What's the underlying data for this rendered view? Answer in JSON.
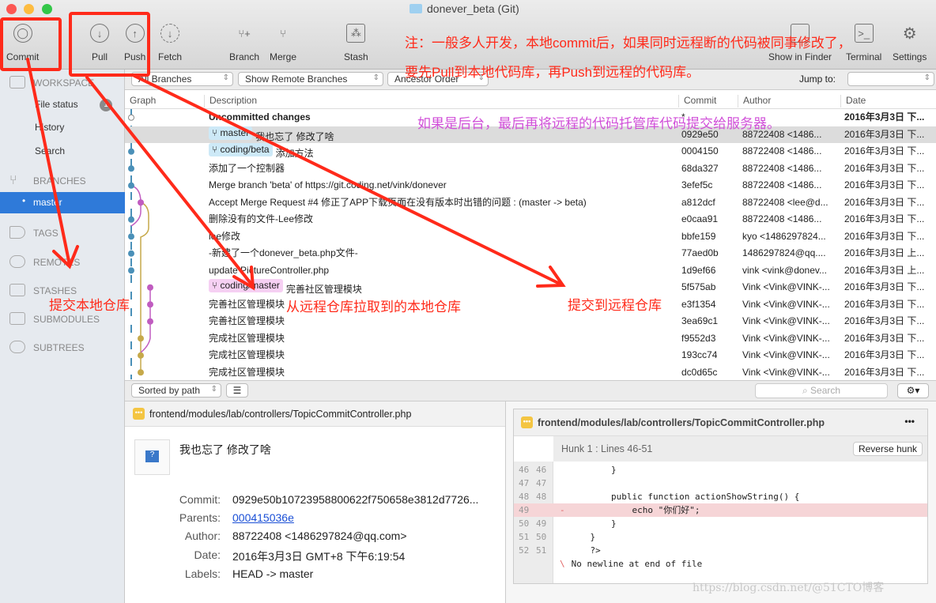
{
  "window": {
    "title": "donever_beta (Git)"
  },
  "toolbar": {
    "commit": "Commit",
    "pull": "Pull",
    "push": "Push",
    "fetch": "Fetch",
    "branch": "Branch",
    "merge": "Merge",
    "stash": "Stash",
    "show_in_finder": "Show in Finder",
    "terminal": "Terminal",
    "settings": "Settings"
  },
  "sidebar": {
    "workspace": "WORKSPACE",
    "file_status": "File status",
    "file_status_count": "1",
    "history": "History",
    "search": "Search",
    "branches": "BRANCHES",
    "master": "master",
    "tags": "TAGS",
    "remotes": "REMOTES",
    "stashes": "STASHES",
    "submodules": "SUBMODULES",
    "subtrees": "SUBTREES"
  },
  "filters": {
    "branches": "All Branches",
    "remote": "Show Remote Branches",
    "order": "Ancestor Order",
    "jump_to": "Jump to:"
  },
  "columns": {
    "graph": "Graph",
    "description": "Description",
    "commit": "Commit",
    "author": "Author",
    "date": "Date"
  },
  "rows": [
    {
      "desc": "Uncommitted changes",
      "commit": "*",
      "author": "",
      "date": "2016年3月3日 下..."
    },
    {
      "tag": "master",
      "desc": "我也忘了 修改了啥",
      "commit": "0929e50",
      "author": "88722408 <1486...",
      "date": "2016年3月3日 下..."
    },
    {
      "tag": "coding/beta",
      "desc": "添加方法",
      "commit": "0004150",
      "author": "88722408 <1486...",
      "date": "2016年3月3日 下..."
    },
    {
      "desc": "添加了一个控制器",
      "commit": "68da327",
      "author": "88722408 <1486...",
      "date": "2016年3月3日 下..."
    },
    {
      "desc": "Merge branch 'beta' of https://git.coding.net/vink/donever",
      "commit": "3efef5c",
      "author": "88722408 <1486...",
      "date": "2016年3月3日 下..."
    },
    {
      "desc": "Accept Merge Request #4 修正了APP下载页面在没有版本时出错的问题 : (master -> beta)",
      "commit": "a812dcf",
      "author": "88722408 <lee@d...",
      "date": "2016年3月3日 下..."
    },
    {
      "desc": "删除没有的文件-Lee修改",
      "commit": "e0caa91",
      "author": "88722408 <1486...",
      "date": "2016年3月3日 下..."
    },
    {
      "desc": "lee修改",
      "commit": "bbfe159",
      "author": "kyo <1486297824...",
      "date": "2016年3月3日 下..."
    },
    {
      "desc": "-新建了一个donever_beta.php文件-",
      "commit": "77aed0b",
      "author": "1486297824@qq....",
      "date": "2016年3月3日 上..."
    },
    {
      "desc": "update PictureController.php",
      "commit": "1d9ef66",
      "author": "vink <vink@donev...",
      "date": "2016年3月3日 上..."
    },
    {
      "tag": "coding/master",
      "desc": "完善社区管理模块",
      "commit": "5f575ab",
      "author": "Vink <Vink@VINK-...",
      "date": "2016年3月3日 下..."
    },
    {
      "desc": "完善社区管理模块",
      "commit": "e3f1354",
      "author": "Vink <Vink@VINK-...",
      "date": "2016年3月3日 下..."
    },
    {
      "desc": "完善社区管理模块",
      "commit": "3ea69c1",
      "author": "Vink <Vink@VINK-...",
      "date": "2016年3月3日 下..."
    },
    {
      "desc": "完成社区管理模块",
      "commit": "f9552d3",
      "author": "Vink <Vink@VINK-...",
      "date": "2016年3月3日 下..."
    },
    {
      "desc": "完成社区管理模块",
      "commit": "193cc74",
      "author": "Vink <Vink@VINK-...",
      "date": "2016年3月3日 下..."
    },
    {
      "desc": "完成社区管理模块",
      "commit": "dc0d65c",
      "author": "Vink <Vink@VINK-...",
      "date": "2016年3月3日 下..."
    }
  ],
  "bottom_bar": {
    "sort": "Sorted by path",
    "search_placeholder": "Search"
  },
  "file": {
    "path": "frontend/modules/lab/controllers/TopicCommitController.php"
  },
  "commit_info": {
    "message": "我也忘了 修改了啥",
    "commit_label": "Commit:",
    "commit": "0929e50b10723958800622f750658e3812d7726...",
    "parents_label": "Parents:",
    "parents": "000415036e",
    "author_label": "Author:",
    "author": "88722408 <1486297824@qq.com>",
    "date_label": "Date:",
    "date": "2016年3月3日 GMT+8 下午6:19:54",
    "labels_label": "Labels:",
    "labels": "HEAD -> master"
  },
  "diff": {
    "file": "frontend/modules/lab/controllers/TopicCommitController.php",
    "hunk": "Hunk 1 : Lines 46-51",
    "reverse": "Reverse hunk",
    "more": "•••",
    "lines": [
      {
        "old": "46",
        "new": "46",
        "sign": "",
        "code": "        }"
      },
      {
        "old": "47",
        "new": "47",
        "sign": "",
        "code": ""
      },
      {
        "old": "48",
        "new": "48",
        "sign": "",
        "code": "        public function actionShowString() {"
      },
      {
        "old": "49",
        "new": "",
        "sign": "-",
        "code": "            echo \"你们好\";"
      },
      {
        "old": "50",
        "new": "49",
        "sign": "",
        "code": "        }"
      },
      {
        "old": "51",
        "new": "50",
        "sign": "",
        "code": "    }"
      },
      {
        "old": "52",
        "new": "51",
        "sign": "",
        "code": "    ?>"
      },
      {
        "old": "",
        "new": "",
        "sign": "\\",
        "code": " No newline at end of file"
      }
    ]
  },
  "annotations": {
    "note1": "注：一般多人开发，本地commit后，如果同时远程断的代码被同事修改了，",
    "note2": "要先Pull到本地代码库，再Push到远程的代码库。",
    "note3": "如果是后台，最后再将远程的代码托管库代码提交给服务器。",
    "commit_local": "提交本地仓库",
    "pull_local": "从远程仓库拉取到的本地仓库",
    "push_remote": "提交到远程仓库"
  },
  "watermark": "https://blog.csdn.net/@51CTO博客",
  "colors": {
    "annotation_red": "#ff2a1a",
    "annotation_purple": "#d04fd8",
    "selection": "#2f7ad9"
  }
}
